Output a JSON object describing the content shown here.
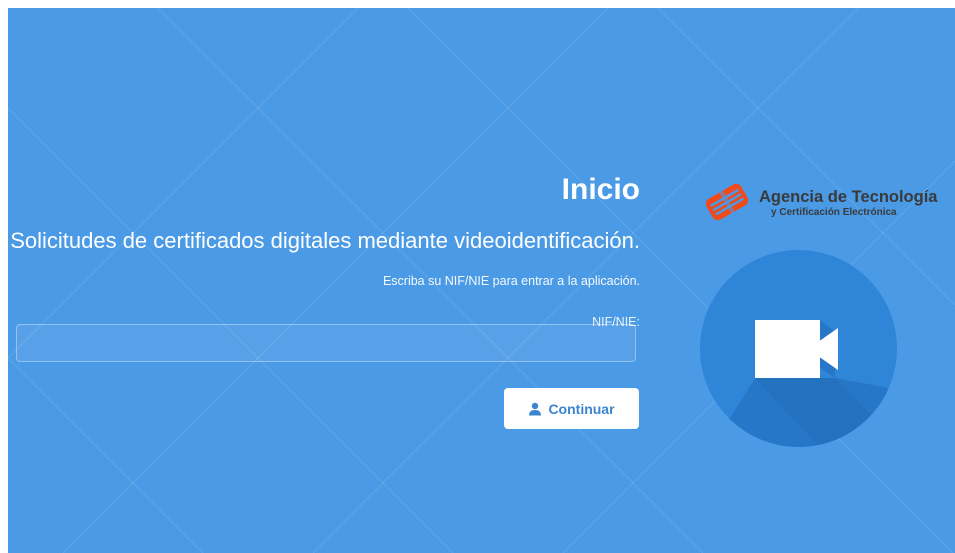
{
  "colors": {
    "background": "#4a9ae6",
    "circle": "#2f86d9",
    "button_text": "#3a85cf",
    "logo_orange": "#f04a1a"
  },
  "main": {
    "title": "Inicio",
    "subtitle": "Solicitudes de certificados digitales mediante videoidentificación.",
    "hint": "Escriba su NIF/NIE para entrar a la aplicación.",
    "field_label": "NIF/NIE:",
    "input_value": "",
    "input_placeholder": "",
    "continue_label": "Continuar",
    "continue_icon": "user-icon"
  },
  "logo": {
    "line1": "Agencia de Tecnología",
    "line2": "y Certificación Electrónica"
  },
  "illustration": {
    "icon": "video-camera-icon"
  }
}
